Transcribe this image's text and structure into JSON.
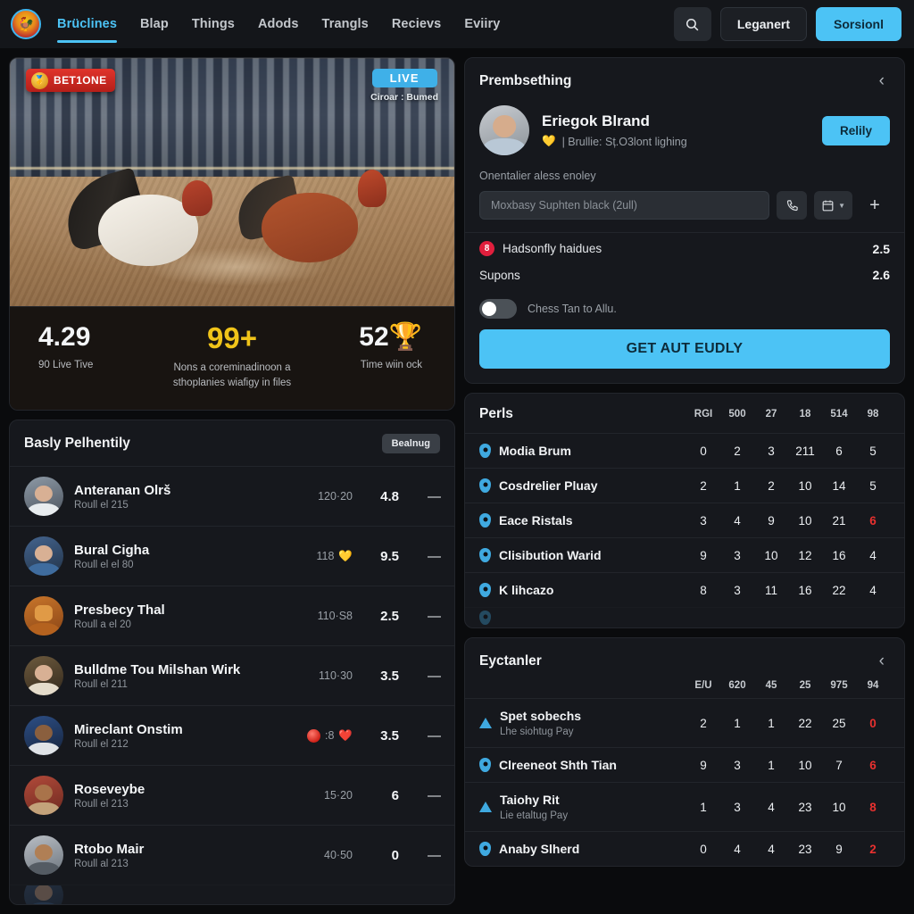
{
  "navbar": {
    "logo_glyph": "🐓",
    "links": [
      {
        "label": "Brüclines",
        "active": true
      },
      {
        "label": "Blap",
        "active": false
      },
      {
        "label": "Things",
        "active": false
      },
      {
        "label": "Adods",
        "active": false
      },
      {
        "label": "Trangls",
        "active": false
      },
      {
        "label": "Recievs",
        "active": false
      },
      {
        "label": "Eviiry",
        "active": false
      }
    ],
    "search_icon": "search-icon",
    "ghost_button": "Leganert",
    "primary_button": "Sorsionl"
  },
  "video": {
    "badge_left": "BET1ONE",
    "badge_left_medal": "🥇",
    "badge_right": "LIVE",
    "badge_right_sub": "Ciroar : Bumed",
    "stats": [
      {
        "value": "4.29",
        "label": "90 Live Tive",
        "gold": false,
        "emoji": ""
      },
      {
        "value": "99+",
        "label": "Nons a coreminadinoon a sthoplanies wiafigy in files",
        "gold": true,
        "emoji": ""
      },
      {
        "value": "52",
        "label": "Time wiin ock",
        "gold": false,
        "emoji": "🏆"
      }
    ]
  },
  "list_panel": {
    "title": "Basly Pelhentily",
    "pill": "Bealnug",
    "rows": [
      {
        "name": "Anteranan Olrš",
        "sub": "Roull el 215",
        "count": "120·20",
        "emoji": "",
        "score": "4.8",
        "dash": "—",
        "av": "a1"
      },
      {
        "name": "Bural Cigha",
        "sub": "Roull el el 80",
        "count": "118",
        "emoji": "💛",
        "score": "9.5",
        "dash": "—",
        "av": "a2"
      },
      {
        "name": "Presbecy Thal",
        "sub": "Roull a el 20",
        "count": "110·S8",
        "emoji": "",
        "score": "2.5",
        "dash": "—",
        "av": "a3"
      },
      {
        "name": "Bulldme Tou Milshan Wirk",
        "sub": "Roull el 211",
        "count": "110·30",
        "emoji": "",
        "score": "3.5",
        "dash": "—",
        "av": "a4"
      },
      {
        "name": "Mireclant Onstim",
        "sub": "Roull el 212",
        "count": ":8",
        "emoji": "❤️",
        "score": "3.5",
        "dash": "—",
        "av": "a5",
        "dot": true
      },
      {
        "name": "Roseveybe",
        "sub": "Roull el 213",
        "count": "15·20",
        "emoji": "",
        "score": "6",
        "dash": "—",
        "av": "a6"
      },
      {
        "name": "Rtobo Mair",
        "sub": "Roull al 213",
        "count": "40·50",
        "emoji": "",
        "score": "0",
        "dash": "—",
        "av": "a7"
      }
    ]
  },
  "chat_panel": {
    "title": "Prembsething",
    "collapse_icon": "chevron-left-icon",
    "profile_name": "Eriegok Blrand",
    "profile_heart": "💛",
    "profile_sub": "| Brullie: Sț.O3lont lighing",
    "reply_button": "Relily",
    "note": "Onentalier aless enoley",
    "input_placeholder": "Moxbasy Suphten black (2ull)",
    "phone_icon": "phone-icon",
    "calendar_icon": "calendar-icon",
    "caret_icon": "chevron-down-icon",
    "plus_icon": "plus-icon",
    "kv_rows": [
      {
        "badge": "8",
        "label": "Hadsonfly haidues",
        "value": "2.5"
      },
      {
        "badge": "",
        "label": "Supons",
        "value": "2.6"
      }
    ],
    "toggle_label": "Chess Tan to Allu.",
    "cta": "GET AUT EUDLY"
  },
  "perls_table": {
    "title": "Perls",
    "columns": [
      "RGI",
      "500",
      "27",
      "18",
      "514",
      "98"
    ],
    "rows": [
      {
        "icon": "pin",
        "label": "Modia Brum",
        "sub": "",
        "values": [
          "0",
          "2",
          "3",
          "211",
          "6",
          "5"
        ],
        "red_index": -1
      },
      {
        "icon": "pin",
        "label": "Cosdrelier Pluay",
        "sub": "",
        "values": [
          "2",
          "1",
          "2",
          "10",
          "14",
          "5"
        ],
        "red_index": -1
      },
      {
        "icon": "pin",
        "label": "Eace Ristals",
        "sub": "",
        "values": [
          "3",
          "4",
          "9",
          "10",
          "21",
          "6"
        ],
        "red_index": 5
      },
      {
        "icon": "pin",
        "label": "Clisibution Warid",
        "sub": "",
        "values": [
          "9",
          "3",
          "10",
          "12",
          "16",
          "4"
        ],
        "red_index": -1
      },
      {
        "icon": "pin",
        "label": "K lihcazo",
        "sub": "",
        "values": [
          "8",
          "3",
          "11",
          "16",
          "22",
          "4"
        ],
        "red_index": -1
      }
    ]
  },
  "bottom_table": {
    "title": "Eyctanler",
    "collapse_icon": "chevron-left-icon",
    "columns": [
      "E/U",
      "620",
      "45",
      "25",
      "975",
      "94"
    ],
    "rows": [
      {
        "icon": "tri",
        "label": "Spet sobechs",
        "sub": "Lhe siohtug Pay",
        "values": [
          "2",
          "1",
          "1",
          "22",
          "25",
          "0"
        ],
        "red_index": 5
      },
      {
        "icon": "pin",
        "label": "Clreeneot Shth Tian",
        "sub": "",
        "values": [
          "9",
          "3",
          "1",
          "10",
          "7",
          "6"
        ],
        "red_index": 5
      },
      {
        "icon": "tri",
        "label": "Taiohy Rit",
        "sub": "Lie etaltug Pay",
        "values": [
          "1",
          "3",
          "4",
          "23",
          "10",
          "8"
        ],
        "red_index": 5
      },
      {
        "icon": "pin",
        "label": "Anaby Slherd",
        "sub": "",
        "values": [
          "0",
          "4",
          "4",
          "23",
          "9",
          "2"
        ],
        "red_index": 5
      }
    ]
  }
}
